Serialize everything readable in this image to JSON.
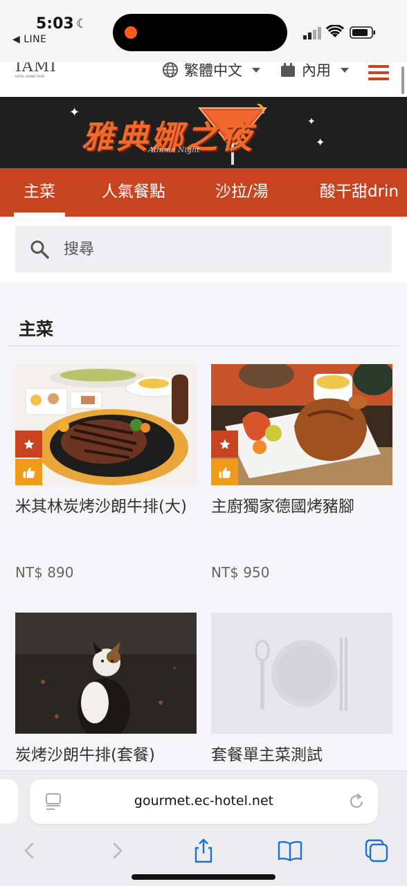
{
  "status_bar": {
    "time": "5:03",
    "back_app": "◀ LINE"
  },
  "header": {
    "logo_mark": "IAMI",
    "logo_sub": "HOTEL GRAND TAIPEI",
    "language": "繁體中文",
    "dining_mode": "內用"
  },
  "banner": {
    "title": "雅典娜之夜",
    "subtitle": "Athena Night"
  },
  "tabs": [
    {
      "label": "主菜",
      "active": true
    },
    {
      "label": "人氣餐點",
      "active": false
    },
    {
      "label": "沙拉/湯",
      "active": false
    },
    {
      "label": "酸干甜drin",
      "active": false
    }
  ],
  "search": {
    "placeholder": "搜尋"
  },
  "section": {
    "title": "主菜"
  },
  "menu_items": [
    {
      "name": "米其林炭烤沙朗牛排(大)",
      "price": "NT$ 890",
      "badges": [
        "star",
        "like"
      ]
    },
    {
      "name": "主廚獨家德國烤豬腳",
      "price": "NT$ 950",
      "badges": [
        "star",
        "like"
      ]
    },
    {
      "name": "炭烤沙朗牛排(套餐)",
      "price": "",
      "badges": []
    },
    {
      "name": "套餐單主菜測試",
      "price": "",
      "badges": []
    }
  ],
  "browser": {
    "url": "gourmet.ec-hotel.net"
  },
  "colors": {
    "brand": "#c8431f",
    "badge_like": "#f29a1a",
    "banner_bg": "#1f1f1f"
  }
}
